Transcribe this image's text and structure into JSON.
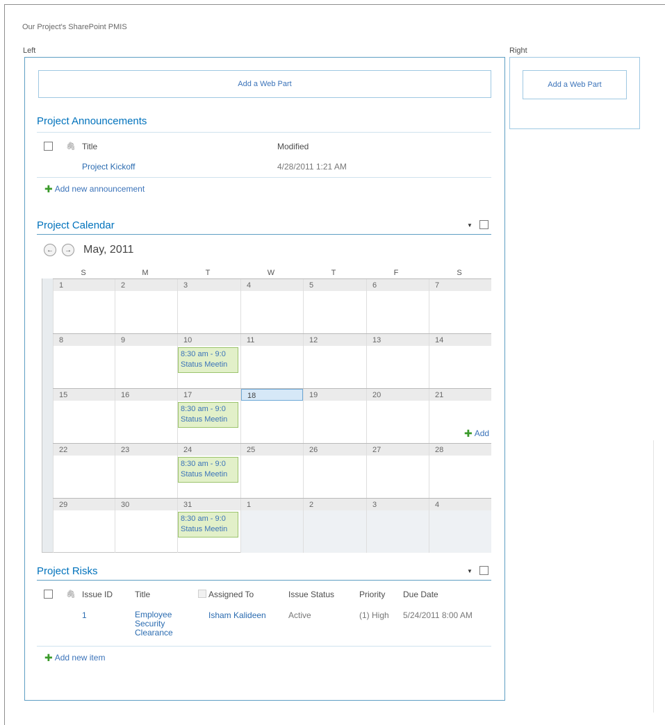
{
  "page": {
    "title": "Our Project's SharePoint PMIS"
  },
  "zones": {
    "left_label": "Left",
    "right_label": "Right",
    "add_web_part": "Add a Web Part"
  },
  "announcements": {
    "title": "Project Announcements",
    "columns": {
      "title": "Title",
      "modified": "Modified"
    },
    "rows": [
      {
        "title": "Project Kickoff",
        "modified": "4/28/2011 1:21 AM"
      }
    ],
    "add_label": "Add new announcement"
  },
  "calendar": {
    "title": "Project Calendar",
    "month_label": "May, 2011",
    "weekdays": [
      "S",
      "M",
      "T",
      "W",
      "T",
      "F",
      "S"
    ],
    "weeks": [
      [
        "1",
        "2",
        "3",
        "4",
        "5",
        "6",
        "7"
      ],
      [
        "8",
        "9",
        "10",
        "11",
        "12",
        "13",
        "14"
      ],
      [
        "15",
        "16",
        "17",
        "18",
        "19",
        "20",
        "21"
      ],
      [
        "22",
        "23",
        "24",
        "25",
        "26",
        "27",
        "28"
      ],
      [
        "29",
        "30",
        "31",
        "1",
        "2",
        "3",
        "4"
      ]
    ],
    "event": {
      "time": "8:30 am - 9:0",
      "title": "Status Meetin"
    },
    "add_label": "Add"
  },
  "risks": {
    "title": "Project Risks",
    "columns": {
      "issue_id": "Issue ID",
      "title": "Title",
      "assigned_to": "Assigned To",
      "issue_status": "Issue Status",
      "priority": "Priority",
      "due_date": "Due Date"
    },
    "rows": [
      {
        "issue_id": "1",
        "title_lines": [
          "Employee",
          "Security",
          "Clearance"
        ],
        "assigned_to": "Isham Kalideen",
        "issue_status": "Active",
        "priority": "(1) High",
        "due_date": "5/24/2011 8:00 AM"
      }
    ],
    "add_label": "Add new item"
  }
}
